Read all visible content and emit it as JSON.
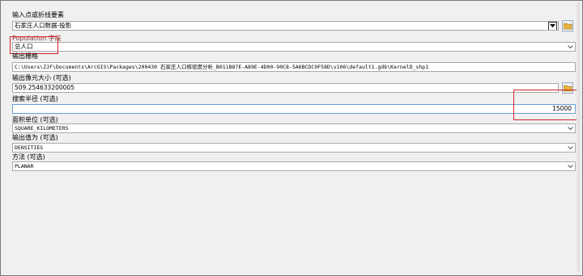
{
  "input_features": {
    "label": "输入点或折线要素",
    "value": "石家庄人口数据-投影"
  },
  "population_field": {
    "label": "Population 字段",
    "value": "总人口"
  },
  "output_raster": {
    "label": "输出栅格",
    "value": "C:\\Users\\ZJF\\Documents\\ArcGIS\\Packages\\200430 石家庄人口核密度分析_B011B87E-A89E-4D00-90C8-5A6BCDC9F58D\\v106\\default1.gdb\\KernelD_shp1"
  },
  "cell_size": {
    "label": "输出像元大小 (可选)",
    "value": "509.254633200005"
  },
  "search_radius": {
    "label": "搜索半径 (可选)",
    "value": "15000"
  },
  "area_units": {
    "label": "面积单位 (可选)",
    "value": "SQUARE_KILOMETERS"
  },
  "output_values": {
    "label": "输出值为 (可选)",
    "value": "DENSITIES"
  },
  "method": {
    "label": "方法 (可选)",
    "value": "PLANAR"
  },
  "colors": {
    "highlight": "#d32424",
    "folder": "#e8b341"
  }
}
